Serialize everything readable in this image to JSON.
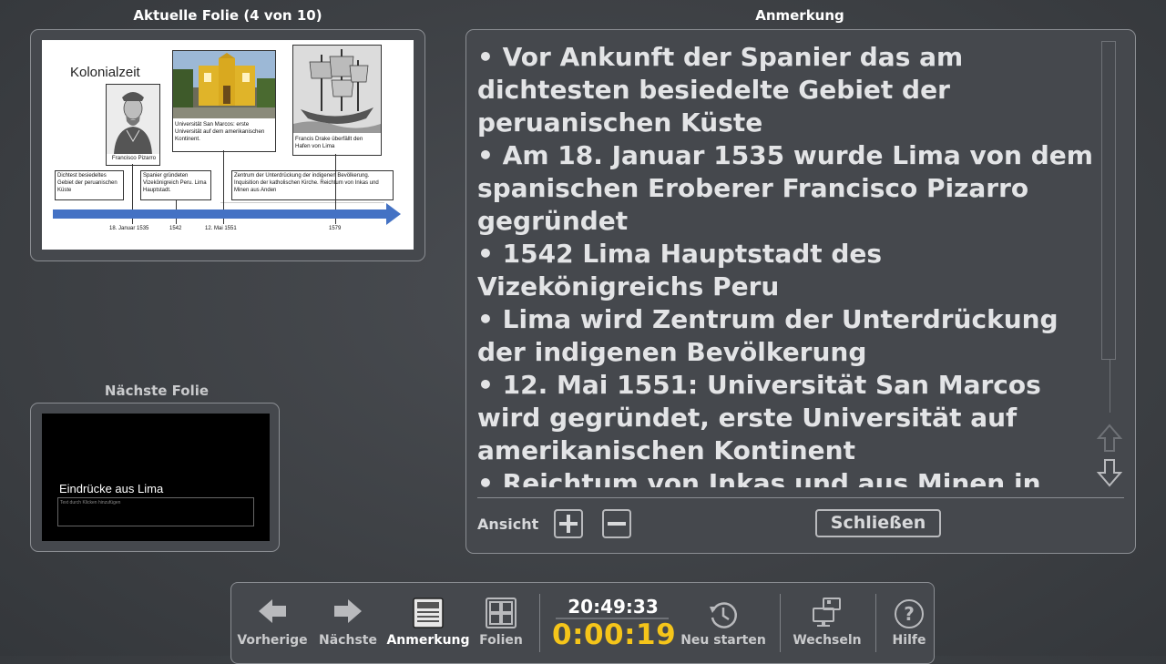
{
  "current_slide": {
    "heading": "Aktuelle Folie (4 von 10)",
    "title": "Kolonialzeit",
    "captions": {
      "pizarro": "Francisco Pizarro",
      "university": "Universität San Marcos: erste Universität auf dem amerikanischen Kontinent.",
      "drake": "Francis Drake überfällt den Hafen von Lima"
    },
    "boxes": {
      "box1": "Dichtest besiedeltes Gebiet der peruanischen Küste",
      "box2": "Spanier gründeten Vizekönigreich Peru. Lima Hauptstadt.",
      "box3": "Zentrum der Unterdrückung der indigenen Bevölkerung. Inquisition der katholischen Kirche. Reichtum von Inkas und Minen aus Anden"
    },
    "dates": [
      "18. Januar 1535",
      "1542",
      "12. Mai 1551",
      "1579"
    ],
    "arrow_color": "#4472c4"
  },
  "next_slide": {
    "heading": "Nächste Folie",
    "title": "Eindrücke aus Lima",
    "placeholder": "Text durch Klicken hinzufügen"
  },
  "notes": {
    "heading": "Anmerkung",
    "paragraphs": [
      "• Vor Ankunft der Spanier das am dichtesten besiedelte Gebiet der peruanischen Küste",
      "• Am 18. Januar 1535 wurde Lima von dem spanischen Eroberer Francisco Pizarro gegründet",
      "• 1542 Lima Hauptstadt des Vizekönigreichs Peru",
      "• Lima wird Zentrum der Unterdrückung der indigenen Bevölkerung",
      "• 12. Mai 1551: Universität San Marcos wird gegründet, erste Universität auf amerikanischen Kontinent",
      "• Reichtum von Inkas und aus Minen in den Anden"
    ],
    "view_label": "Ansicht",
    "close_label": "Schließen"
  },
  "toolbar": {
    "prev_label": "Vorherige",
    "next_label": "Nächste",
    "notes_label": "Anmerkung",
    "slides_label": "Folien",
    "clock": "20:49:33",
    "timer": "0:00:19",
    "restart_label": "Neu starten",
    "switch_label": "Wechseln",
    "help_label": "Hilfe"
  },
  "colors": {
    "timer": "#f5c51a",
    "background": "#3f4246"
  }
}
